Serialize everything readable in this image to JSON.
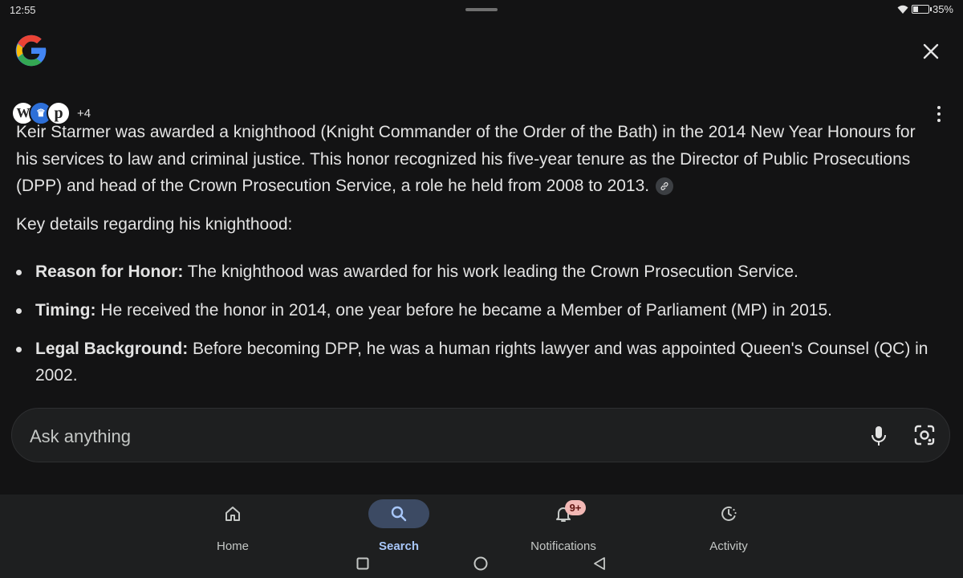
{
  "status_bar": {
    "time": "12:55",
    "battery_percent": "35%",
    "battery_level": 0.35
  },
  "header": {
    "logo_icon": "google-g-logo",
    "close_icon": "close-icon"
  },
  "sources": {
    "icons": [
      "wikipedia-icon",
      "crown-icon",
      "p-source-icon"
    ],
    "extra_count": "+4"
  },
  "answer": {
    "paragraph": "Keir Starmer was awarded a knighthood (Knight Commander of the Order of the Bath) in the 2014 New Year Honours for his services to law and criminal justice. This honor recognized his five-year tenure as the Director of Public Prosecutions (DPP) and head of the Crown Prosecution Service, a role he held from 2008 to 2013.",
    "link_icon": "link-icon",
    "key_details": "Key details regarding his knighthood:",
    "bullets": [
      {
        "label": "Reason for Honor:",
        "text": " The knighthood was awarded for his work leading the Crown Prosecution Service."
      },
      {
        "label": "Timing:",
        "text": " He received the honor in 2014, one year before he became a Member of Parliament (MP) in 2015."
      },
      {
        "label": "Legal Background:",
        "text": " Before becoming DPP, he was a human rights lawyer and was appointed Queen's Counsel (QC) in 2002."
      }
    ]
  },
  "ask": {
    "placeholder": "Ask anything",
    "value": ""
  },
  "bottom_nav": {
    "items": [
      {
        "label": "Home",
        "icon": "home-icon"
      },
      {
        "label": "Search",
        "icon": "search-icon",
        "active": true
      },
      {
        "label": "Notifications",
        "icon": "bell-icon",
        "badge": "9+"
      },
      {
        "label": "Activity",
        "icon": "activity-icon"
      }
    ]
  },
  "colors": {
    "background": "#131314",
    "nav_background": "#1e1f20",
    "active_pill": "#3c4a63",
    "active_label": "#a8c7fa",
    "badge": "#f2b8b5",
    "text": "#e3e3e3"
  }
}
